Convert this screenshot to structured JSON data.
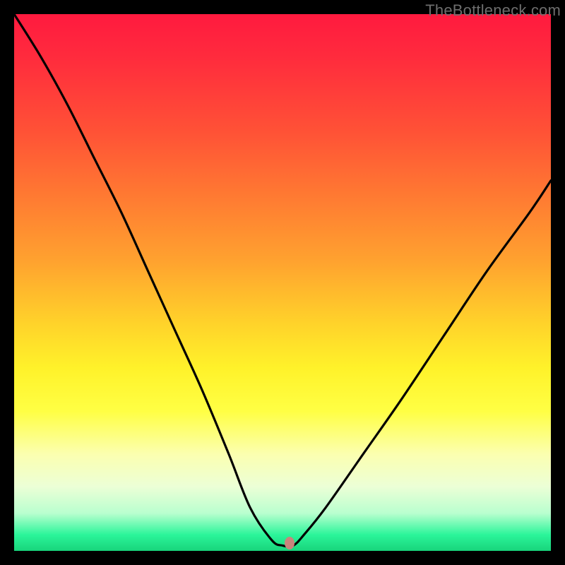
{
  "watermark": "TheBottleneck.com",
  "gradient_colors": {
    "top": "#ff1a3f",
    "mid_upper": "#ff7a32",
    "mid": "#ffd42a",
    "mid_lower": "#fbffb0",
    "bottom": "#18d47b"
  },
  "marker": {
    "x_frac": 0.513,
    "y_frac": 0.985,
    "color": "#c9847c"
  },
  "chart_data": {
    "type": "line",
    "title": "",
    "xlabel": "",
    "ylabel": "",
    "xlim": [
      0,
      100
    ],
    "ylim": [
      0,
      100
    ],
    "series": [
      {
        "name": "curve",
        "x": [
          0,
          5,
          10,
          15,
          20,
          25,
          30,
          35,
          40,
          44,
          48,
          50,
          52,
          54,
          58,
          65,
          72,
          80,
          88,
          96,
          100
        ],
        "values": [
          100,
          92,
          83,
          73,
          63,
          52,
          41,
          30,
          18,
          8,
          2,
          1,
          1,
          3,
          8,
          18,
          28,
          40,
          52,
          63,
          69
        ]
      }
    ],
    "marker_point": {
      "x": 51.3,
      "y": 1.5
    },
    "background": "red-yellow-green vertical gradient",
    "frame": "black"
  }
}
